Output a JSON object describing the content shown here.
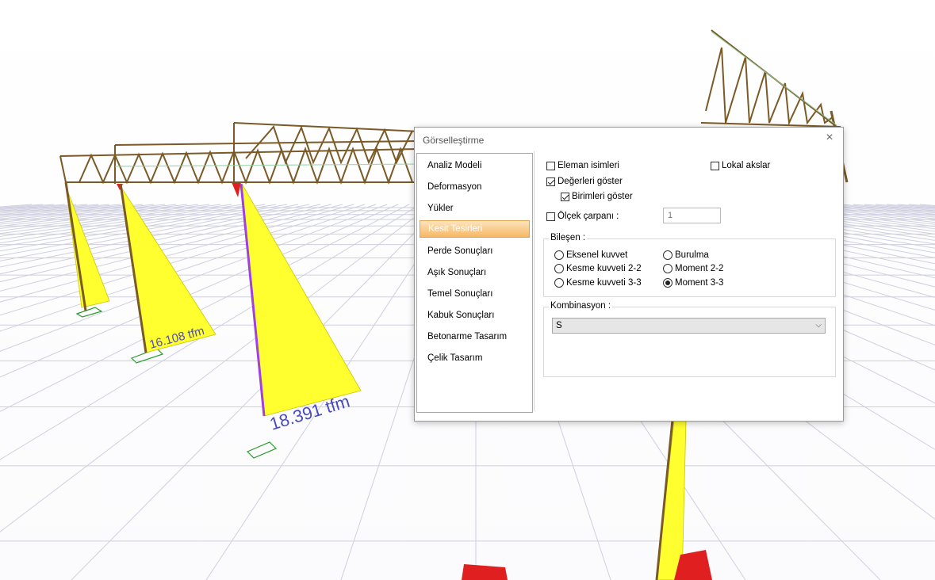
{
  "viewport": {
    "labels": [
      "16.108 tfm",
      "18.391 tfm"
    ],
    "colors": {
      "frame": "#7a5a26",
      "diagram": "#ffff30",
      "grid": "#c8c8d8",
      "member_selected": "#a040e0"
    }
  },
  "dialog": {
    "title": "Görselleştirme",
    "close_icon": "×",
    "nav": [
      "Analiz Modeli",
      "Deformasyon",
      "Yükler",
      "Kesit Tesirleri",
      "Perde Sonuçları",
      "Aşık Sonuçları",
      "Temel Sonuçları",
      "Kabuk Sonuçları",
      "Betonarme Tasarım",
      "Çelik Tasarım"
    ],
    "selected_nav": "Kesit Tesirleri",
    "options": {
      "eleman_isimleri": "Eleman isimleri",
      "lokal_akslar": "Lokal akslar",
      "degerleri_goster": "Değerleri göster",
      "birimleri_goster": "Birimleri göster",
      "olcek_carpani": "Ölçek çarpanı :",
      "olcek_value": "1"
    },
    "bilesen": {
      "label": "Bileşen :",
      "items": [
        "Eksenel kuvvet",
        "Kesme kuvveti 2-2",
        "Kesme kuvveti 3-3",
        "Burulma",
        "Moment 2-2",
        "Moment 3-3"
      ],
      "selected": "Moment 3-3"
    },
    "kombinasyon": {
      "label": "Kombinasyon :",
      "value": "S",
      "dropdown_icon": "chevron-down-icon"
    }
  }
}
